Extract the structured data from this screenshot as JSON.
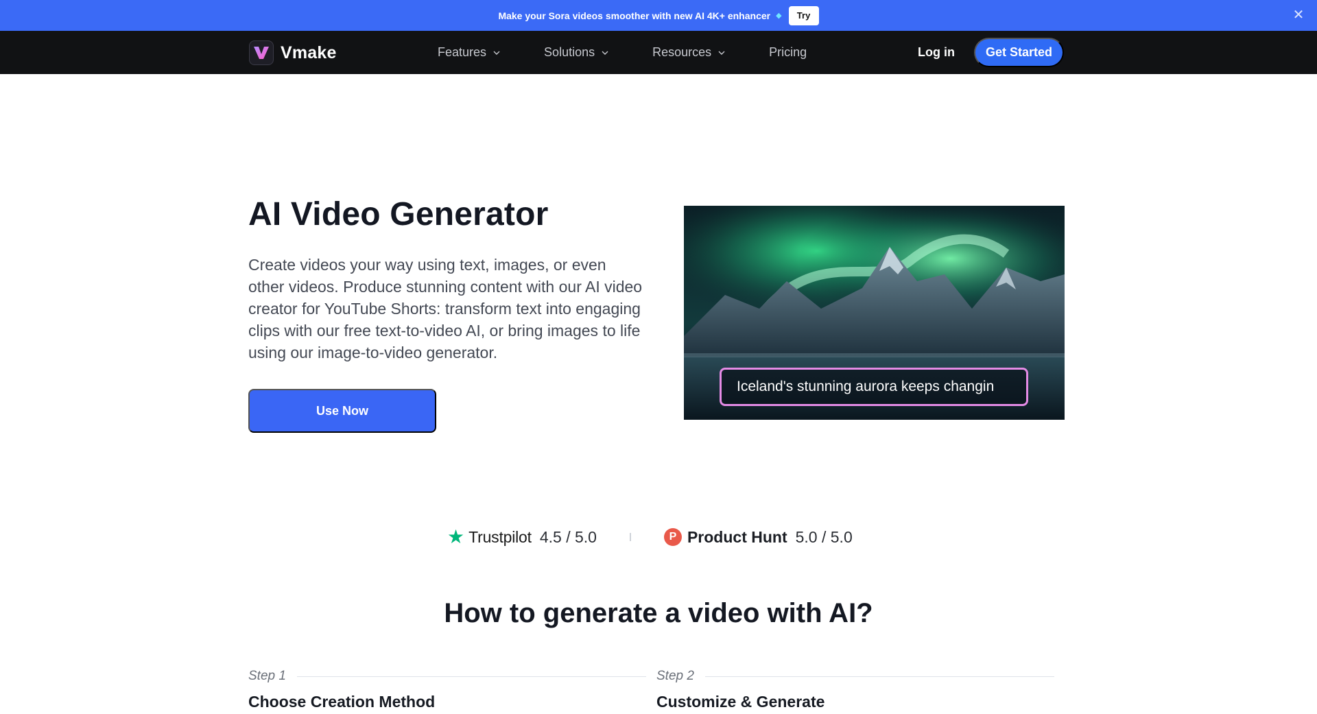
{
  "promo": {
    "text": "Make your Sora videos smoother with new AI 4K+ enhancer",
    "try_label": "Try",
    "close_icon": "close-icon",
    "background": "#3b6af6"
  },
  "nav": {
    "brand": "Vmake",
    "items": [
      {
        "label": "Features",
        "has_dropdown": true
      },
      {
        "label": "Solutions",
        "has_dropdown": true
      },
      {
        "label": "Resources",
        "has_dropdown": true
      },
      {
        "label": "Pricing",
        "has_dropdown": false
      }
    ],
    "login": "Log in",
    "get_started": "Get Started",
    "accent": "#2f6bf5"
  },
  "hero": {
    "title": "AI Video Generator",
    "description": "Create videos your way using text, images, or even other videos. Produce stunning content with our AI video creator for YouTube Shorts: transform text into engaging clips with our free text-to-video AI, or bring images to life using our image-to-video generator.",
    "cta": "Use Now",
    "caption": "Iceland's stunning aurora keeps changin"
  },
  "ratings": [
    {
      "brand": "Trustpilot",
      "score": "4.5 / 5.0",
      "icon": "star-icon"
    },
    {
      "brand": "Product Hunt",
      "score": "5.0 / 5.0",
      "icon": "product-hunt-icon",
      "badge": "P"
    }
  ],
  "how_to": {
    "title": "How to generate a video with AI?",
    "steps": [
      {
        "label": "Step 1",
        "title": "Choose Creation Method"
      },
      {
        "label": "Step 2",
        "title": "Customize & Generate"
      }
    ]
  }
}
